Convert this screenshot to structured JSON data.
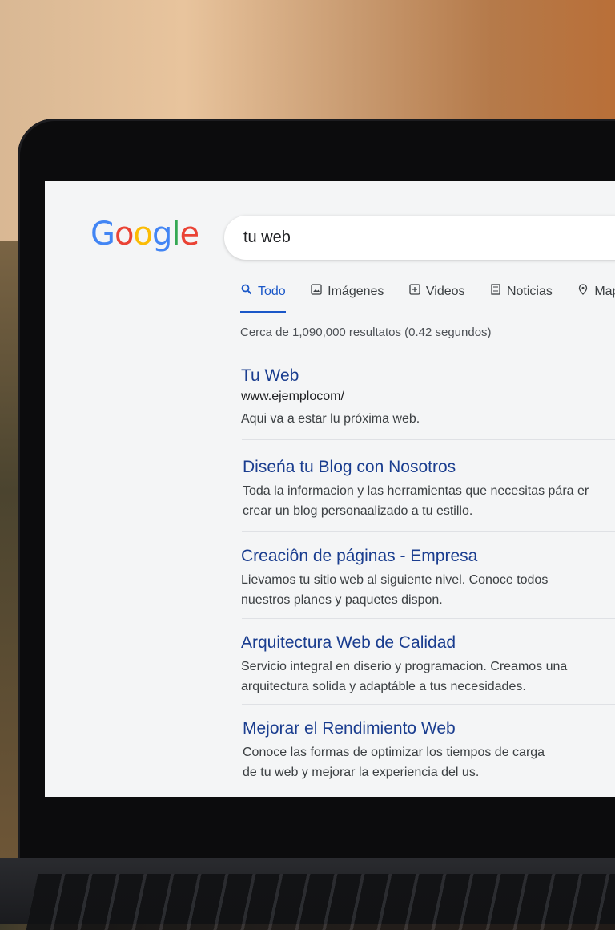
{
  "logo": {
    "letters": [
      "G",
      "o",
      "o",
      "g",
      "l",
      "e"
    ],
    "colors": [
      "#4285F4",
      "#EA4335",
      "#FBBC05",
      "#4285F4",
      "#34A853",
      "#EA4335"
    ]
  },
  "search": {
    "query": "tu web"
  },
  "tabs": [
    {
      "label": "Todo",
      "icon": "search-icon",
      "active": true
    },
    {
      "label": "Imágenes",
      "icon": "image-icon",
      "active": false
    },
    {
      "label": "Videos",
      "icon": "video-icon",
      "active": false
    },
    {
      "label": "Noticias",
      "icon": "news-icon",
      "active": false
    },
    {
      "label": "Maps",
      "icon": "map-pin-icon",
      "active": false
    }
  ],
  "stats": "Cerca de 1,090,000 resultatos (0.42 segundos)",
  "results": [
    {
      "title": "Tu Web",
      "url": "www.ejemplocom/",
      "desc1": "Aqui va a estar lu próxima web.",
      "desc2": ""
    },
    {
      "title": "Diseńa tu Blog con Nosotros",
      "url": "",
      "desc1": "Toda la informacion y las herramientas que necesitas pára er",
      "desc2": "crear un blog personaalizado a tu estillo."
    },
    {
      "title": "Creaciôn de páginas - Empresa",
      "url": "",
      "desc1": "Lievamos tu sitio web al siguiente nivel. Conoce todos",
      "desc2": "nuestros planes y paquetes dispon."
    },
    {
      "title": "Arquitectura Web de Calidad",
      "url": "",
      "desc1": "Servicio integral en diserio y programacion. Creamos una",
      "desc2": "arquitectura solida y adaptáble a tus necesidades."
    },
    {
      "title": "Mejorar el Rendimiento Web",
      "url": "",
      "desc1": "Conoce las formas de optimizar los tiempos de carga",
      "desc2": "de tu web y mejorar la experiencia del us."
    }
  ],
  "colors": {
    "link": "#1a3d8f",
    "accent": "#1a57c8"
  }
}
